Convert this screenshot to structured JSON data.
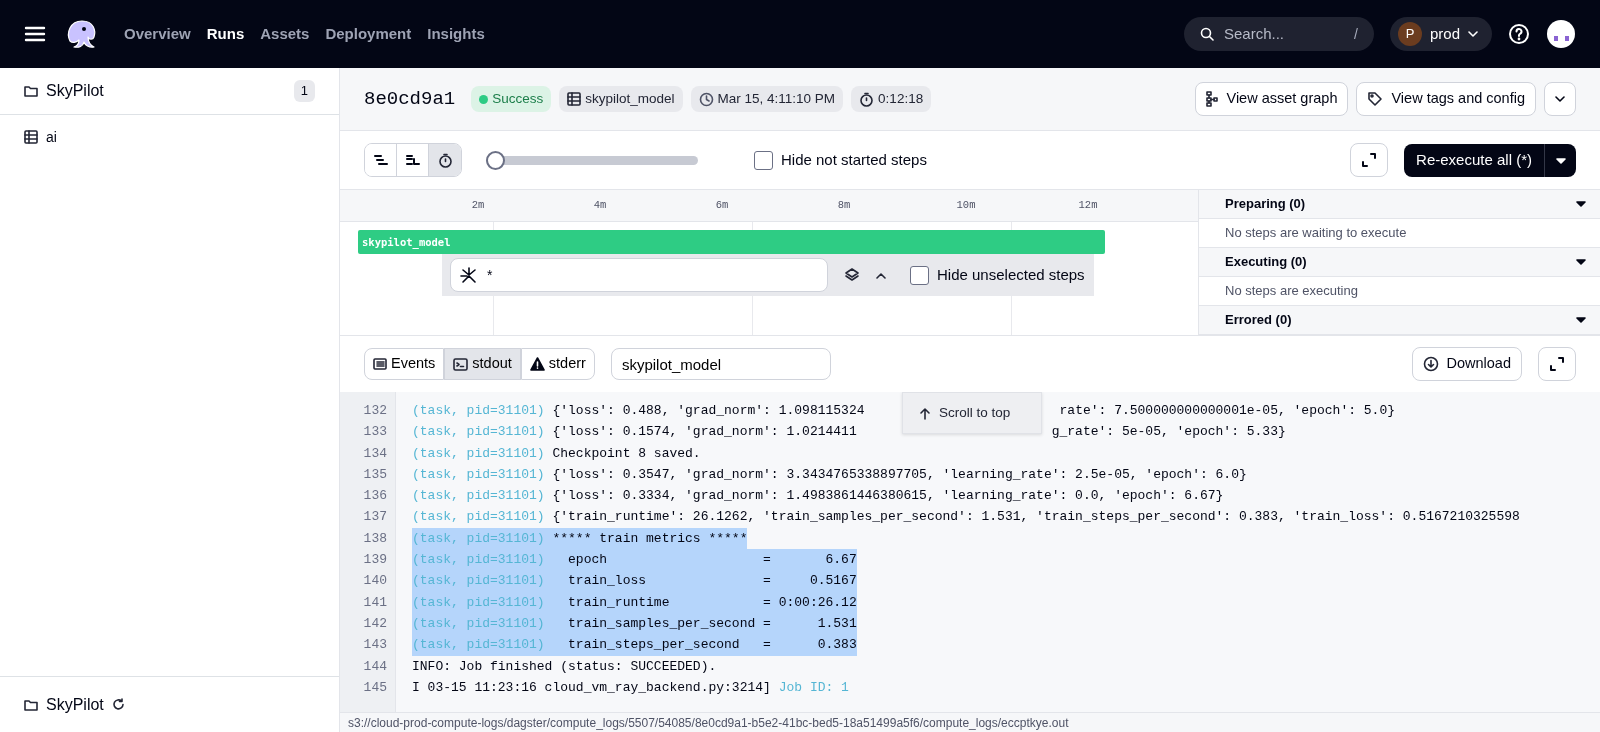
{
  "nav": {
    "items": [
      {
        "label": "Overview",
        "selected": false
      },
      {
        "label": "Runs",
        "selected": true
      },
      {
        "label": "Assets",
        "selected": false
      },
      {
        "label": "Deployment",
        "selected": false
      },
      {
        "label": "Insights",
        "selected": false
      }
    ],
    "search": {
      "placeholder": "Search...",
      "shortcut": "/"
    },
    "deployment": {
      "initial": "P",
      "label": "prod"
    }
  },
  "sidebar": {
    "items": [
      {
        "label": "SkyPilot",
        "kind": "folder",
        "count": "1"
      },
      {
        "label": "ai",
        "kind": "table"
      }
    ],
    "footer": {
      "label": "SkyPilot"
    }
  },
  "run": {
    "id": "8e0cd9a1",
    "status": "Success",
    "tags": [
      {
        "kind": "job",
        "label": "skypilot_model"
      },
      {
        "kind": "time",
        "label": "Mar 15, 4:11:10 PM"
      },
      {
        "kind": "duration",
        "label": "0:12:18"
      }
    ],
    "actions": [
      "View asset graph",
      "View tags and config"
    ]
  },
  "toolbar": {
    "views": [
      {
        "kind": "waterfall",
        "selected": false
      },
      {
        "kind": "flat",
        "selected": false
      },
      {
        "kind": "timer",
        "selected": true
      }
    ],
    "zoom": {
      "level": 0
    },
    "hide_not_started": {
      "label": "Hide not started steps",
      "checked": false
    },
    "reexecute": "Re-execute all (*)"
  },
  "gantt": {
    "ticks": [
      "2m",
      "4m",
      "6m",
      "8m",
      "10m",
      "12m"
    ],
    "steps": [
      {
        "name": "skypilot_model"
      }
    ],
    "filter": {
      "value": "*"
    },
    "hide_unselected": {
      "label": "Hide unselected steps",
      "checked": false
    }
  },
  "step_panel": [
    {
      "title": "Preparing (0)",
      "empty": "No steps are waiting to execute"
    },
    {
      "title": "Executing (0)",
      "empty": "No steps are executing"
    },
    {
      "title": "Errored (0)"
    }
  ],
  "logs": {
    "tabs": [
      {
        "label": "Events",
        "kind": "events",
        "selected": false
      },
      {
        "label": "stdout",
        "kind": "stdout",
        "selected": true
      },
      {
        "label": "stderr",
        "kind": "stderr",
        "selected": false
      }
    ],
    "step_filter": {
      "value": "skypilot_model"
    },
    "download": "Download",
    "scroll_to_top": "Scroll to top",
    "lines": [
      {
        "number": "132",
        "prefix": "(task, pid=31101)",
        "segments": [
          "{'loss': 0.488, 'grad_norm': 1.098115324",
          "rate': 7.500000000000001e-05, 'epoch': 5.0}"
        ],
        "selected": false
      },
      {
        "number": "133",
        "prefix": "(task, pid=31101)",
        "segments": [
          "{'loss': 0.1574, 'grad_norm': 1.0214411",
          "g_rate': 5e-05, 'epoch': 5.33}"
        ],
        "selected": false
      },
      {
        "number": "134",
        "prefix": "(task, pid=31101)",
        "segments": [
          "Checkpoint 8 saved."
        ],
        "selected": false
      },
      {
        "number": "135",
        "prefix": "(task, pid=31101)",
        "segments": [
          "{'loss': 0.3547, 'grad_norm': 3.3434765338897705, 'learning_rate': 2.5e-05, 'epoch': 6.0}"
        ],
        "selected": false
      },
      {
        "number": "136",
        "prefix": "(task, pid=31101)",
        "segments": [
          "{'loss': 0.3334, 'grad_norm': 1.4983861446380615, 'learning_rate': 0.0, 'epoch': 6.67}"
        ],
        "selected": false
      },
      {
        "number": "137",
        "prefix": "(task, pid=31101)",
        "segments": [
          "{'train_runtime': 26.1262, 'train_samples_per_second': 1.531, 'train_steps_per_second': 0.383, 'train_loss': 0.5167210325598"
        ],
        "selected": false
      },
      {
        "number": "138",
        "prefix": "(task, pid=31101)",
        "segments": [
          "***** train metrics *****"
        ],
        "selected": true
      },
      {
        "number": "139",
        "prefix": "(task, pid=31101)",
        "segments": [
          "  epoch                    =       6.67"
        ],
        "selected": true
      },
      {
        "number": "140",
        "prefix": "(task, pid=31101)",
        "segments": [
          "  train_loss               =     0.5167"
        ],
        "selected": true
      },
      {
        "number": "141",
        "prefix": "(task, pid=31101)",
        "segments": [
          "  train_runtime            = 0:00:26.12"
        ],
        "selected": true
      },
      {
        "number": "142",
        "prefix": "(task, pid=31101)",
        "segments": [
          "  train_samples_per_second =      1.531"
        ],
        "selected": true
      },
      {
        "number": "143",
        "prefix": "(task, pid=31101)",
        "segments": [
          "  train_steps_per_second   =      0.383"
        ],
        "selected": true
      },
      {
        "number": "144",
        "segments": [
          "INFO: Job finished (status: SUCCEEDED)."
        ],
        "selected": false
      },
      {
        "number": "145",
        "segments": [
          "I 03-15 11:23:16 cloud_vm_ray_backend.py:3214]"
        ],
        "suffix": "Job ID: 1",
        "selected": false
      }
    ]
  },
  "status_bar": "s3://cloud-prod-compute-logs/dagster/compute_logs/5507/54085/8e0cd9a1-b5e2-41bc-bed5-18a51499a5f6/compute_logs/eccptkye.out"
}
